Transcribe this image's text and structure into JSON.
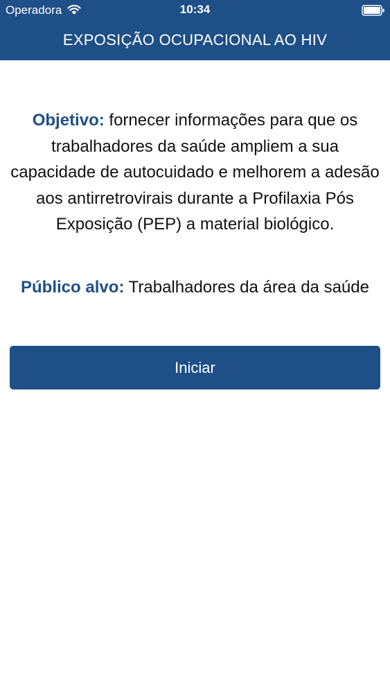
{
  "status_bar": {
    "carrier": "Operadora",
    "time": "10:34",
    "wifi_icon": "wifi-icon",
    "battery_icon": "battery-full-icon"
  },
  "nav": {
    "title": "EXPOSIÇÃO OCUPACIONAL AO HIV"
  },
  "content": {
    "objective_label": "Objetivo:",
    "objective_text": " fornecer informações para que os trabalhadores da saúde ampliem a sua capacidade de autocuidado e melhorem a adesão aos antirretrovirais durante a Profilaxia Pós Exposição (PEP) a material biológico.",
    "audience_label": "Público alvo:",
    "audience_text": " Trabalhadores da área da saúde"
  },
  "actions": {
    "start_label": "Iniciar"
  },
  "colors": {
    "primary": "#1f4f87",
    "background": "#ffffff",
    "text": "#111111"
  }
}
